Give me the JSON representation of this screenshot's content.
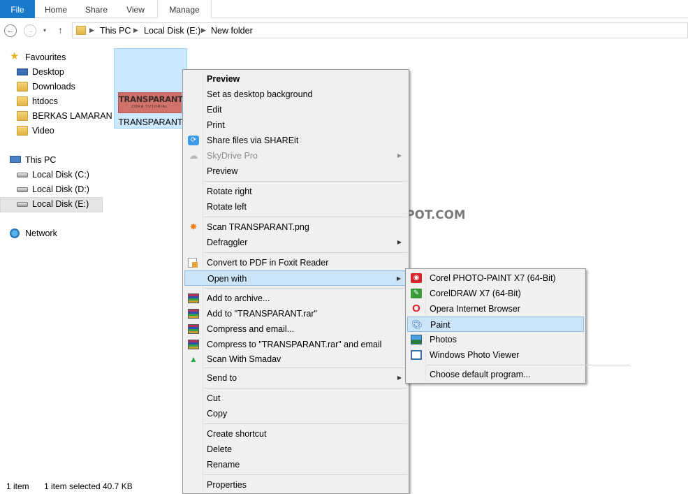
{
  "ribbon": {
    "tabs": [
      "File",
      "Home",
      "Share",
      "View",
      "Manage"
    ]
  },
  "address": {
    "back": "←",
    "forward": "→",
    "recent": "▾",
    "up": "↑",
    "crumbs": [
      "This PC",
      "Local Disk (E:)",
      "New folder"
    ]
  },
  "sidebar": {
    "favourites": "Favourites",
    "fav_items": [
      "Desktop",
      "Downloads",
      "htdocs",
      "BERKAS LAMARAN",
      "Video"
    ],
    "this_pc": "This PC",
    "drives": [
      "Local Disk (C:)",
      "Local Disk (D:)",
      "Local Disk (E:)"
    ],
    "network": "Network",
    "selected": "Local Disk (E:)"
  },
  "file": {
    "thumb_title": "TRANSPARANT",
    "thumb_subtitle": "ZORA TUTORIAL",
    "name": "TRANSPARANT"
  },
  "watermark": "ZOTUTORIAL.BLOGSPOT.COM",
  "status": {
    "count": "1 item",
    "selected": "1 item selected",
    "size": "40.7 KB"
  },
  "context_menu": {
    "items": [
      "Preview",
      "Set as desktop background",
      "Edit",
      "Print",
      "Share files via SHAREit",
      "SkyDrive Pro",
      "Preview",
      "Rotate right",
      "Rotate left",
      "Scan TRANSPARANT.png",
      "Defraggler",
      "Convert to PDF in Foxit Reader",
      "Open with",
      "Add to archive...",
      "Add to \"TRANSPARANT.rar\"",
      "Compress and email...",
      "Compress to \"TRANSPARANT.rar\" and email",
      "Scan With Smadav",
      "Send to",
      "Cut",
      "Copy",
      "Create shortcut",
      "Delete",
      "Rename",
      "Properties"
    ],
    "submenu_arrow": "▶",
    "highlighted": "Open with"
  },
  "open_with_menu": {
    "items": [
      "Corel PHOTO-PAINT X7 (64-Bit)",
      "CorelDRAW X7 (64-Bit)",
      "Opera Internet Browser",
      "Paint",
      "Photos",
      "Windows Photo Viewer",
      "Choose default program..."
    ],
    "highlighted": "Paint"
  },
  "colors": {
    "file_tab": "#1979ca",
    "selection": "#cce8ff",
    "menu_highlight": "#cce4f7",
    "menu_bg": "#f0f0f0"
  }
}
